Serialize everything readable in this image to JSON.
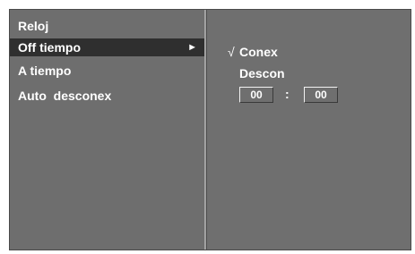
{
  "menu": {
    "items": [
      {
        "label": "Reloj",
        "selected": false
      },
      {
        "label": "Off tiempo",
        "selected": true
      },
      {
        "label": "A tiempo",
        "selected": false
      },
      {
        "label": "Auto  desconex",
        "selected": false
      }
    ],
    "submenu_arrow": "►"
  },
  "submenu": {
    "check_mark": "√",
    "options": [
      "Conex",
      "Descon"
    ],
    "time": {
      "hour": "00",
      "separator": ":",
      "minute": "00"
    }
  },
  "colors": {
    "panel_bg": "#6f6f6f",
    "highlight_bg": "#2f2f2f",
    "text": "#ffffff"
  }
}
